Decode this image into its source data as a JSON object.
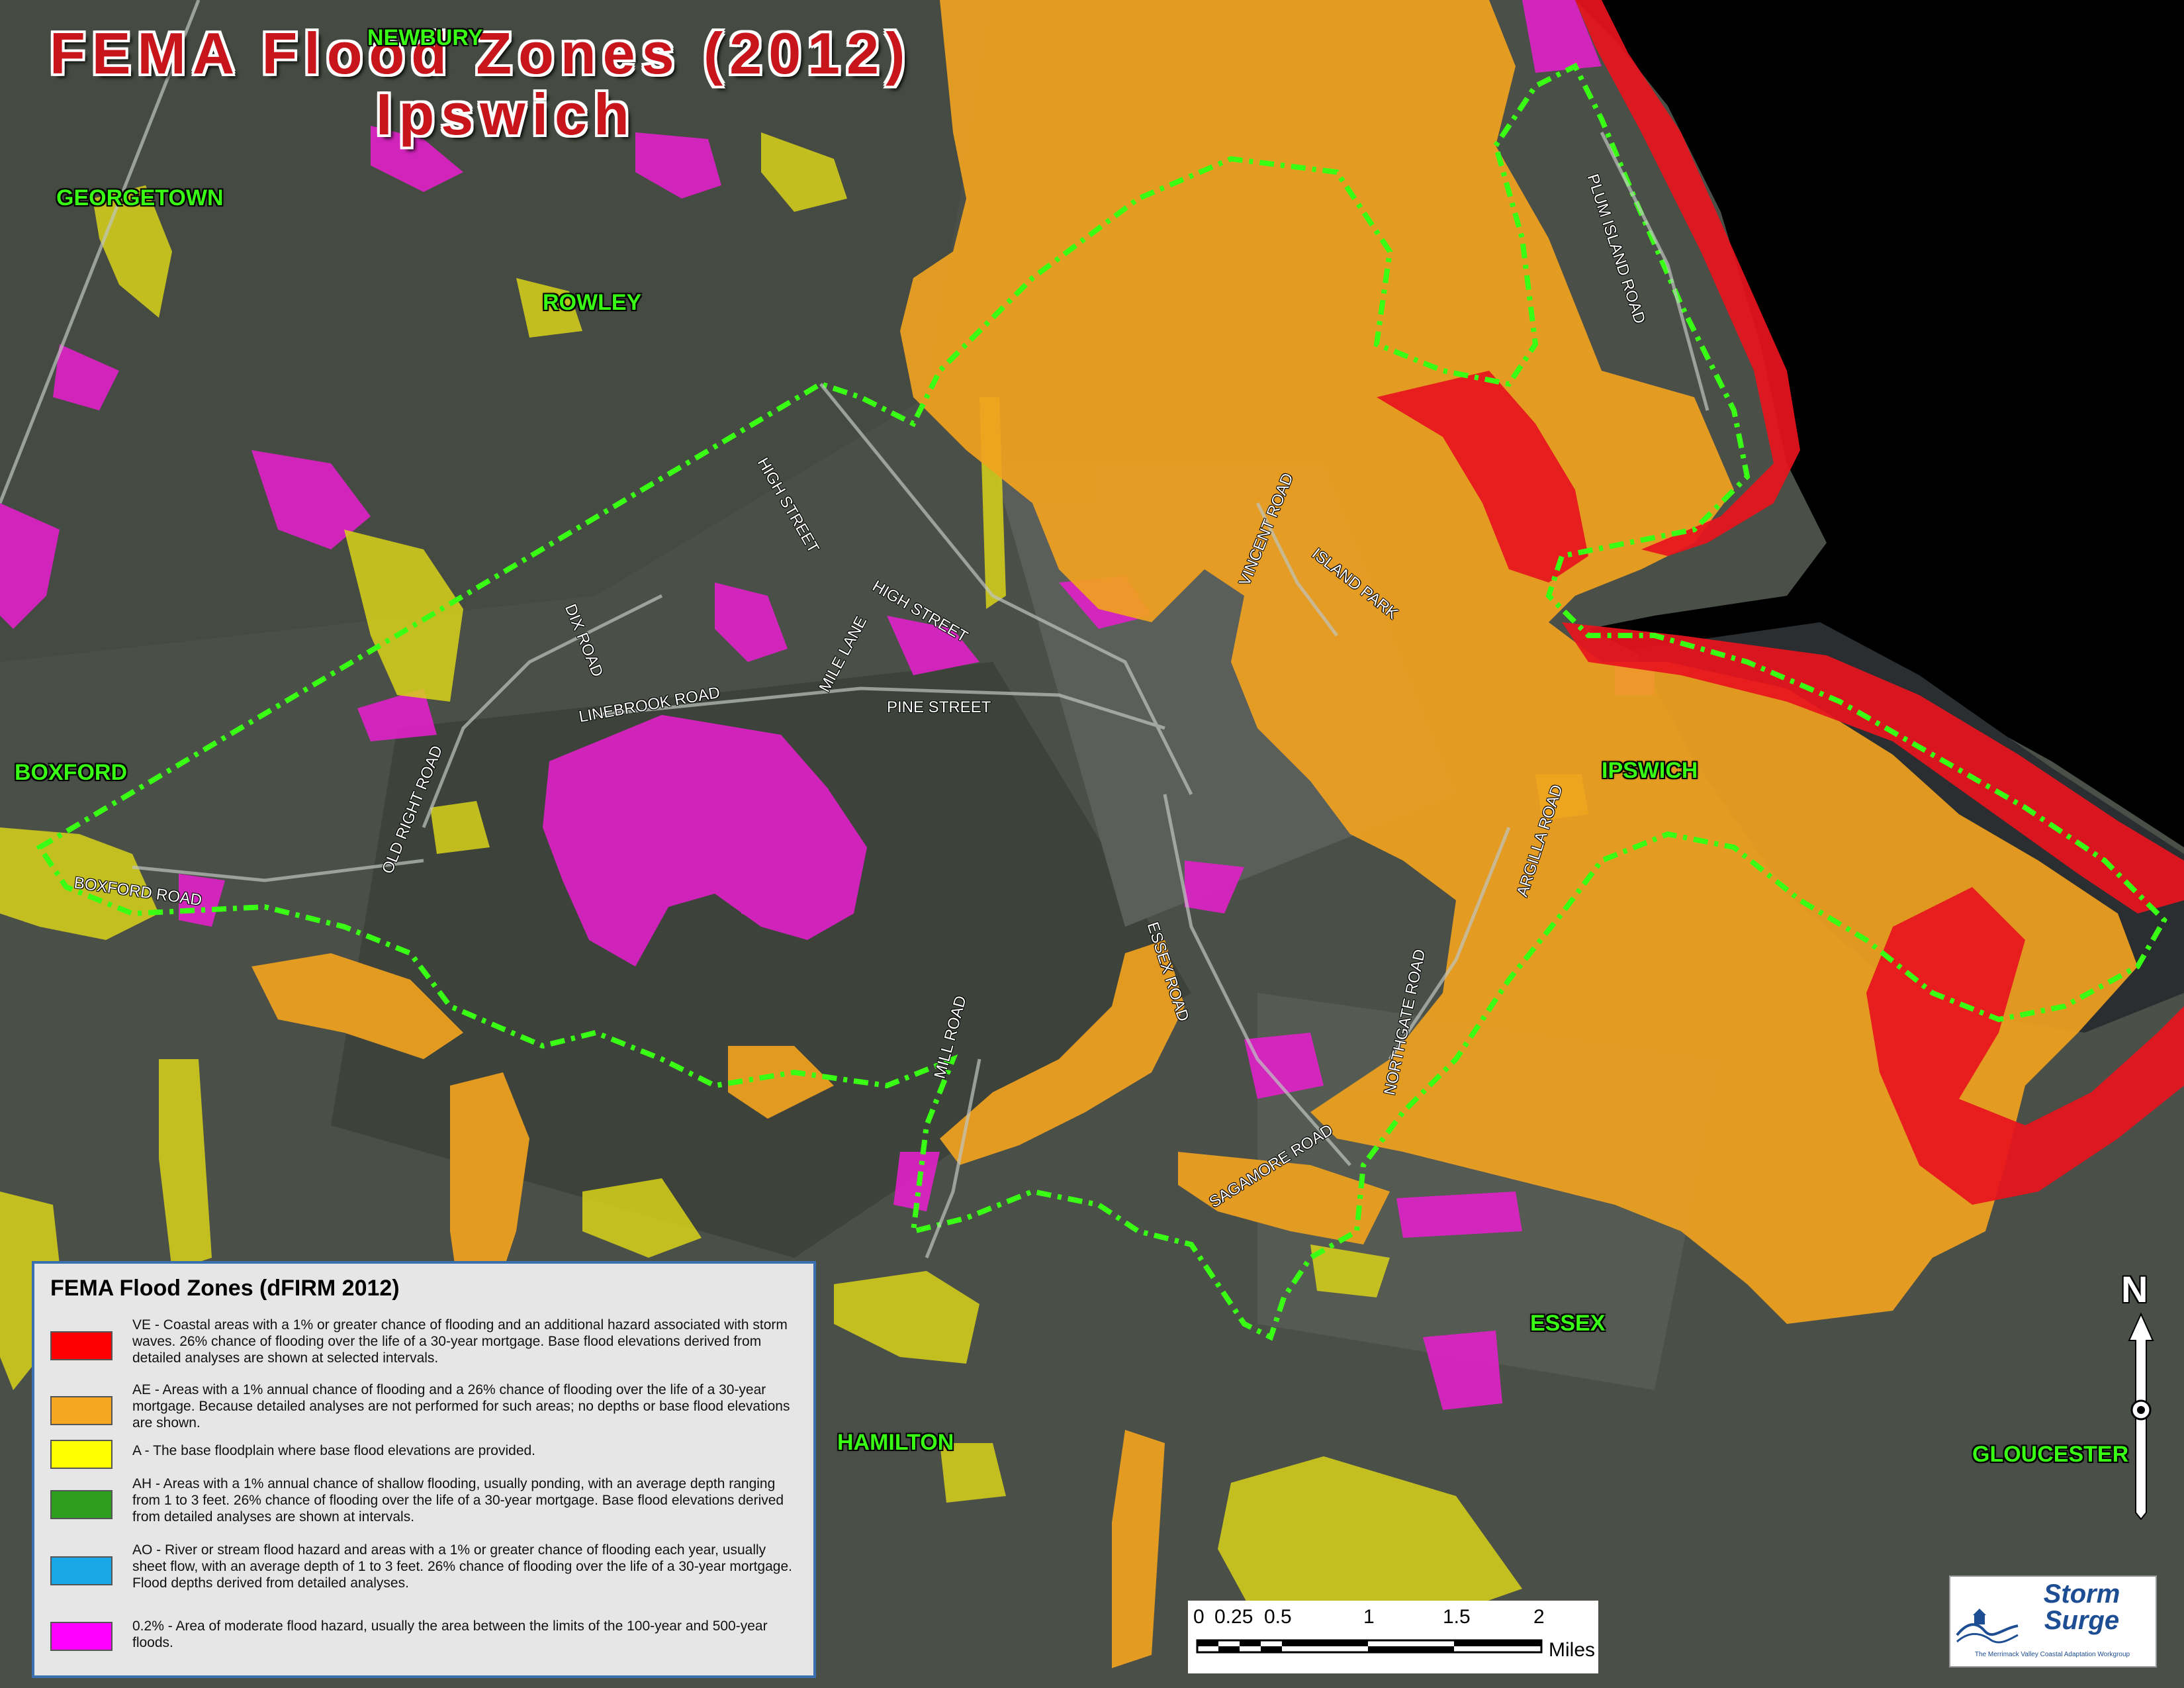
{
  "title": {
    "line1": "FEMA Flood Zones (2012)",
    "line2": "Ipswich"
  },
  "towns": {
    "newbury": "NEWBURY",
    "georgetown": "GEORGETOWN",
    "rowley": "ROWLEY",
    "boxford": "BOXFORD",
    "ipswich": "IPSWICH",
    "essex": "ESSEX",
    "hamilton": "HAMILTON",
    "gloucester": "GLOUCESTER"
  },
  "roads": {
    "plum_island": "PLUM ISLAND ROAD",
    "vincent": "VINCENT ROAD",
    "island_park": "ISLAND PARK",
    "high_street_1": "HIGH STREET",
    "high_street_2": "HIGH STREET",
    "dix": "DIX ROAD",
    "mile_lane": "MILE LANE",
    "pine": "PINE STREET",
    "linebrook": "LINEBROOK ROAD",
    "old_right": "OLD RIGHT ROAD",
    "boxford": "BOXFORD ROAD",
    "argilla": "ARGILLA ROAD",
    "essex": "ESSEX ROAD",
    "northgate": "NORTHGATE ROAD",
    "mill": "MILL ROAD",
    "sagamore": "SAGAMORE ROAD"
  },
  "legend": {
    "title": "FEMA Flood Zones (dFIRM 2012)",
    "items": [
      {
        "color": "#ff0000",
        "text": "VE - Coastal areas with a 1% or greater chance of flooding and an additional hazard associated with storm waves. 26% chance of flooding over the life of a 30-year mortgage. Base flood elevations derived from detailed analyses are shown at selected intervals."
      },
      {
        "color": "#f5a623",
        "text": "AE - Areas with a 1% annual chance of flooding and a 26% chance of flooding over the life of a 30-year mortgage. Because detailed analyses are not performed for such areas; no depths or base flood elevations are shown."
      },
      {
        "color": "#ffff00",
        "text": "A - The base floodplain where base flood elevations are provided."
      },
      {
        "color": "#2e9e1e",
        "text": "AH - Areas with a 1% annual chance of shallow flooding, usually ponding, with an average depth ranging from 1 to 3 feet. 26% chance of flooding over the life of a 30-year mortgage. Base flood elevations derived from detailed analyses are shown at intervals."
      },
      {
        "color": "#1aa7e8",
        "text": "AO - River or stream flood hazard and areas with a 1% or greater chance of flooding each year, usually sheet flow, with an average depth of 1 to 3 feet. 26% chance of flooding over the life of a 30-year mortgage. Flood depths derived from detailed analyses."
      },
      {
        "color": "#ff00ff",
        "text": "0.2% - Area of moderate flood hazard, usually the area between the limits of the 100-year and 500-year floods."
      }
    ]
  },
  "scale": {
    "ticks": [
      "0",
      "0.25",
      "0.5",
      "1",
      "1.5",
      "2"
    ],
    "unit": "Miles"
  },
  "north_label": "N",
  "logo": {
    "name_line1": "Storm",
    "name_line2": "Surge",
    "subtitle": "The Merrimack Valley Coastal Adaptation Workgroup"
  },
  "colors": {
    "ve": "#e8141e",
    "ae": "#f0a21f",
    "a": "#d9d21a",
    "x500": "#e020c8",
    "boundary": "#39ff14",
    "land": "#3f4440",
    "ocean": "#000000"
  }
}
